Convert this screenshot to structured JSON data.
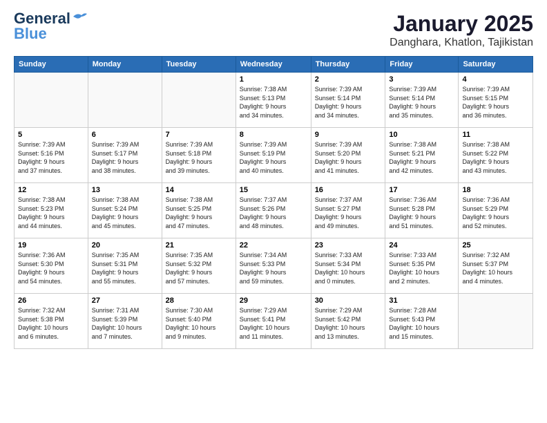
{
  "header": {
    "logo_line1": "General",
    "logo_line2": "Blue",
    "title": "January 2025",
    "subtitle": "Danghara, Khatlon, Tajikistan"
  },
  "weekdays": [
    "Sunday",
    "Monday",
    "Tuesday",
    "Wednesday",
    "Thursday",
    "Friday",
    "Saturday"
  ],
  "weeks": [
    [
      {
        "day": "",
        "info": ""
      },
      {
        "day": "",
        "info": ""
      },
      {
        "day": "",
        "info": ""
      },
      {
        "day": "1",
        "info": "Sunrise: 7:38 AM\nSunset: 5:13 PM\nDaylight: 9 hours\nand 34 minutes."
      },
      {
        "day": "2",
        "info": "Sunrise: 7:39 AM\nSunset: 5:14 PM\nDaylight: 9 hours\nand 34 minutes."
      },
      {
        "day": "3",
        "info": "Sunrise: 7:39 AM\nSunset: 5:14 PM\nDaylight: 9 hours\nand 35 minutes."
      },
      {
        "day": "4",
        "info": "Sunrise: 7:39 AM\nSunset: 5:15 PM\nDaylight: 9 hours\nand 36 minutes."
      }
    ],
    [
      {
        "day": "5",
        "info": "Sunrise: 7:39 AM\nSunset: 5:16 PM\nDaylight: 9 hours\nand 37 minutes."
      },
      {
        "day": "6",
        "info": "Sunrise: 7:39 AM\nSunset: 5:17 PM\nDaylight: 9 hours\nand 38 minutes."
      },
      {
        "day": "7",
        "info": "Sunrise: 7:39 AM\nSunset: 5:18 PM\nDaylight: 9 hours\nand 39 minutes."
      },
      {
        "day": "8",
        "info": "Sunrise: 7:39 AM\nSunset: 5:19 PM\nDaylight: 9 hours\nand 40 minutes."
      },
      {
        "day": "9",
        "info": "Sunrise: 7:39 AM\nSunset: 5:20 PM\nDaylight: 9 hours\nand 41 minutes."
      },
      {
        "day": "10",
        "info": "Sunrise: 7:38 AM\nSunset: 5:21 PM\nDaylight: 9 hours\nand 42 minutes."
      },
      {
        "day": "11",
        "info": "Sunrise: 7:38 AM\nSunset: 5:22 PM\nDaylight: 9 hours\nand 43 minutes."
      }
    ],
    [
      {
        "day": "12",
        "info": "Sunrise: 7:38 AM\nSunset: 5:23 PM\nDaylight: 9 hours\nand 44 minutes."
      },
      {
        "day": "13",
        "info": "Sunrise: 7:38 AM\nSunset: 5:24 PM\nDaylight: 9 hours\nand 45 minutes."
      },
      {
        "day": "14",
        "info": "Sunrise: 7:38 AM\nSunset: 5:25 PM\nDaylight: 9 hours\nand 47 minutes."
      },
      {
        "day": "15",
        "info": "Sunrise: 7:37 AM\nSunset: 5:26 PM\nDaylight: 9 hours\nand 48 minutes."
      },
      {
        "day": "16",
        "info": "Sunrise: 7:37 AM\nSunset: 5:27 PM\nDaylight: 9 hours\nand 49 minutes."
      },
      {
        "day": "17",
        "info": "Sunrise: 7:36 AM\nSunset: 5:28 PM\nDaylight: 9 hours\nand 51 minutes."
      },
      {
        "day": "18",
        "info": "Sunrise: 7:36 AM\nSunset: 5:29 PM\nDaylight: 9 hours\nand 52 minutes."
      }
    ],
    [
      {
        "day": "19",
        "info": "Sunrise: 7:36 AM\nSunset: 5:30 PM\nDaylight: 9 hours\nand 54 minutes."
      },
      {
        "day": "20",
        "info": "Sunrise: 7:35 AM\nSunset: 5:31 PM\nDaylight: 9 hours\nand 55 minutes."
      },
      {
        "day": "21",
        "info": "Sunrise: 7:35 AM\nSunset: 5:32 PM\nDaylight: 9 hours\nand 57 minutes."
      },
      {
        "day": "22",
        "info": "Sunrise: 7:34 AM\nSunset: 5:33 PM\nDaylight: 9 hours\nand 59 minutes."
      },
      {
        "day": "23",
        "info": "Sunrise: 7:33 AM\nSunset: 5:34 PM\nDaylight: 10 hours\nand 0 minutes."
      },
      {
        "day": "24",
        "info": "Sunrise: 7:33 AM\nSunset: 5:35 PM\nDaylight: 10 hours\nand 2 minutes."
      },
      {
        "day": "25",
        "info": "Sunrise: 7:32 AM\nSunset: 5:37 PM\nDaylight: 10 hours\nand 4 minutes."
      }
    ],
    [
      {
        "day": "26",
        "info": "Sunrise: 7:32 AM\nSunset: 5:38 PM\nDaylight: 10 hours\nand 6 minutes."
      },
      {
        "day": "27",
        "info": "Sunrise: 7:31 AM\nSunset: 5:39 PM\nDaylight: 10 hours\nand 7 minutes."
      },
      {
        "day": "28",
        "info": "Sunrise: 7:30 AM\nSunset: 5:40 PM\nDaylight: 10 hours\nand 9 minutes."
      },
      {
        "day": "29",
        "info": "Sunrise: 7:29 AM\nSunset: 5:41 PM\nDaylight: 10 hours\nand 11 minutes."
      },
      {
        "day": "30",
        "info": "Sunrise: 7:29 AM\nSunset: 5:42 PM\nDaylight: 10 hours\nand 13 minutes."
      },
      {
        "day": "31",
        "info": "Sunrise: 7:28 AM\nSunset: 5:43 PM\nDaylight: 10 hours\nand 15 minutes."
      },
      {
        "day": "",
        "info": ""
      }
    ]
  ]
}
